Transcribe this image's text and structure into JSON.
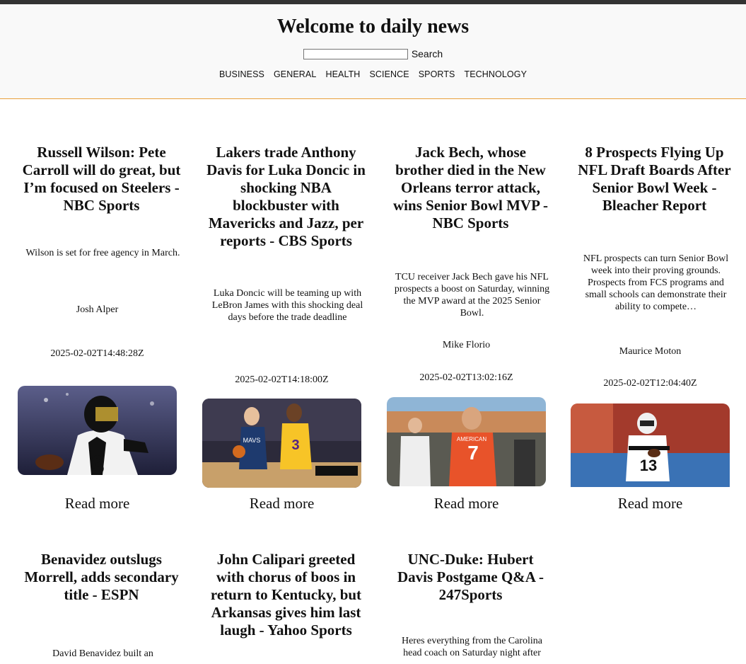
{
  "header": {
    "title": "Welcome to daily news",
    "search_placeholder": "",
    "search_value": "",
    "search_label": "Search",
    "categories": [
      "BUSINESS",
      "GENERAL",
      "HEALTH",
      "SCIENCE",
      "SPORTS",
      "TECHNOLOGY"
    ]
  },
  "articles": [
    {
      "title": "Russell Wilson: Pete Carroll will do great, but I’m focused on Steelers - NBC Sports",
      "description": "Wilson is set for free agency in March.",
      "author": "Josh Alper",
      "date": "2025-02-02T14:48:28Z",
      "read_more": "Read more",
      "image_icon": "football-player-photo"
    },
    {
      "title": "Lakers trade Anthony Davis for Luka Doncic in shocking NBA blockbuster with Mavericks and Jazz, per reports - CBS Sports",
      "description": "Luka Doncic will be teaming up with LeBron James with this shocking deal days before the trade deadline",
      "author": "",
      "date": "2025-02-02T14:18:00Z",
      "read_more": "Read more",
      "image_icon": "basketball-players-photo"
    },
    {
      "title": "Jack Bech, whose brother died in the New Orleans terror attack, wins Senior Bowl MVP - NBC Sports",
      "description": "TCU receiver Jack Bech gave his NFL prospects a boost on Saturday, winning the MVP award at the 2025 Senior Bowl.",
      "author": "Mike Florio",
      "date": "2025-02-02T13:02:16Z",
      "read_more": "Read more",
      "image_icon": "football-player-celebration-photo"
    },
    {
      "title": "8 Prospects Flying Up NFL Draft Boards After Senior Bowl Week - Bleacher Report",
      "description": "NFL prospects can turn Senior Bowl week into their proving grounds. Prospects from FCS programs and small schools can demonstrate their ability to compete…",
      "author": "Maurice Moton",
      "date": "2025-02-02T12:04:40Z",
      "read_more": "Read more",
      "image_icon": "football-runner-photo"
    },
    {
      "title": "Benavidez outslugs Morrell, adds secondary title - ESPN",
      "description": "David Benavidez built an",
      "author": "",
      "date": "",
      "read_more": "",
      "image_icon": ""
    },
    {
      "title": "John Calipari greeted with chorus of boos in return to Kentucky, but Arkansas gives him last laugh - Yahoo Sports",
      "description": "",
      "author": "",
      "date": "",
      "read_more": "",
      "image_icon": ""
    },
    {
      "title": "UNC-Duke: Hubert Davis Postgame Q&A - 247Sports",
      "description": "Heres everything from the Carolina head coach on Saturday night after",
      "author": "",
      "date": "",
      "read_more": "",
      "image_icon": ""
    }
  ]
}
